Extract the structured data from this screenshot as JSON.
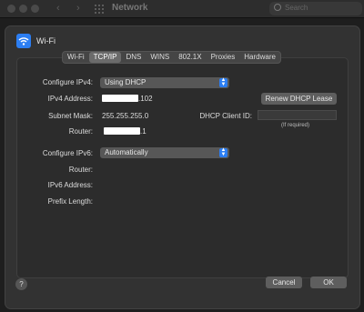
{
  "window": {
    "title": "Network",
    "search_placeholder": "Search"
  },
  "service": {
    "name": "Wi-Fi",
    "icon": "wifi-icon",
    "icon_color": "#2c7ef2"
  },
  "tabs": [
    {
      "label": "Wi-Fi"
    },
    {
      "label": "TCP/IP",
      "active": true
    },
    {
      "label": "DNS"
    },
    {
      "label": "WINS"
    },
    {
      "label": "802.1X"
    },
    {
      "label": "Proxies"
    },
    {
      "label": "Hardware"
    }
  ],
  "tcpip": {
    "configure_ipv4_label": "Configure IPv4:",
    "configure_ipv4_value": "Using DHCP",
    "ipv4_address_label": "IPv4 Address:",
    "ipv4_address_suffix": ".102",
    "renew_button": "Renew DHCP Lease",
    "subnet_mask_label": "Subnet Mask:",
    "subnet_mask_value": "255.255.255.0",
    "dhcp_client_id_label": "DHCP Client ID:",
    "dhcp_client_id_value": "",
    "if_required": "(If required)",
    "router_label": "Router:",
    "router_suffix": ".1",
    "configure_ipv6_label": "Configure IPv6:",
    "configure_ipv6_value": "Automatically",
    "router6_label": "Router:",
    "ipv6_address_label": "IPv6 Address:",
    "prefix_length_label": "Prefix Length:"
  },
  "footer": {
    "help": "?",
    "cancel": "Cancel",
    "ok": "OK"
  }
}
